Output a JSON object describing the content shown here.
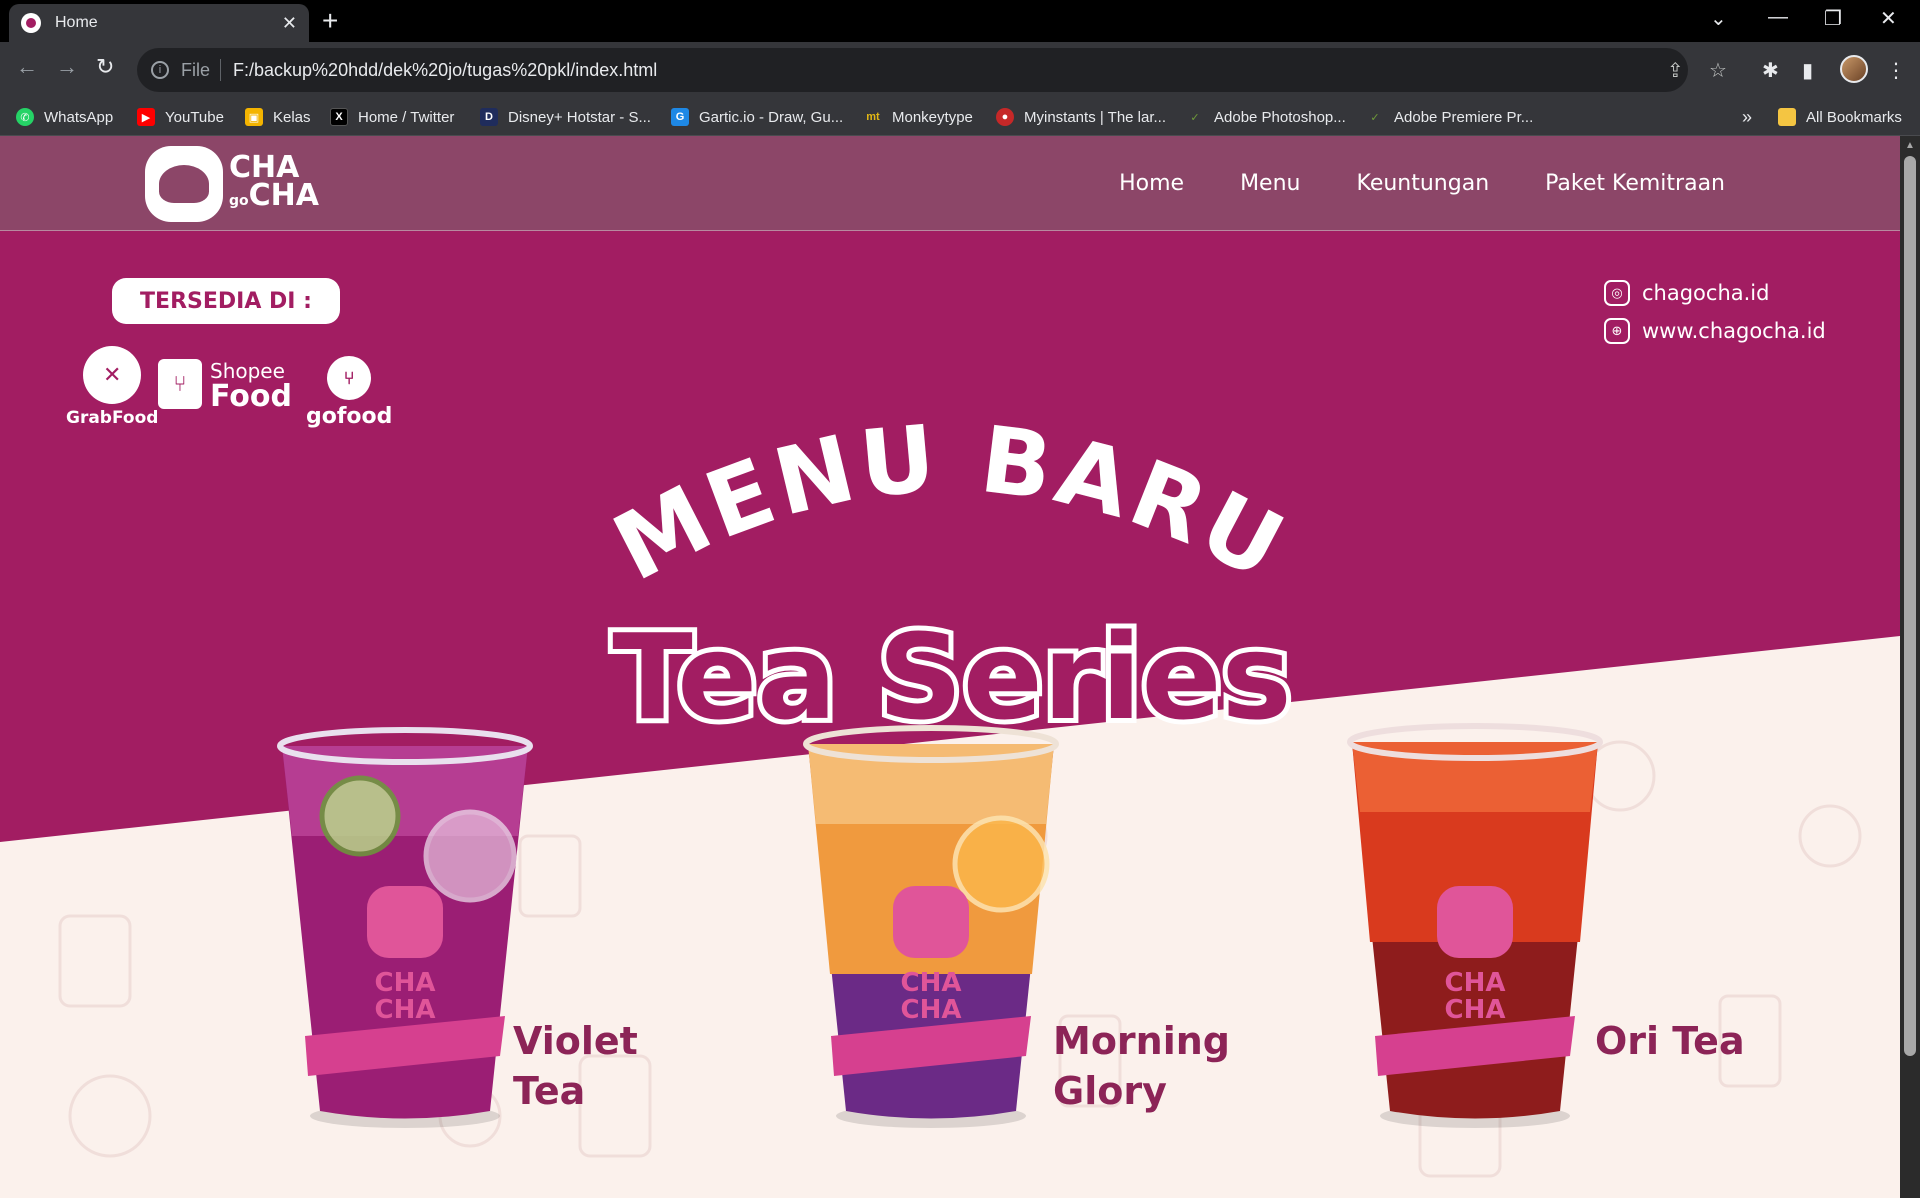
{
  "browser": {
    "tab_title": "Home",
    "url_scheme": "File",
    "url": "F:/backup%20hdd/dek%20jo/tugas%20pkl/index.html",
    "bookmarks": [
      {
        "label": "WhatsApp",
        "icon": "whatsapp-icon",
        "color": "#25d366"
      },
      {
        "label": "YouTube",
        "icon": "youtube-icon",
        "color": "#ff0000"
      },
      {
        "label": "Kelas",
        "icon": "classroom-icon",
        "color": "#f4b400"
      },
      {
        "label": "Home / Twitter",
        "icon": "x-icon",
        "color": "#000000"
      },
      {
        "label": "Disney+ Hotstar - S...",
        "icon": "hotstar-icon",
        "color": "#1f2c5c"
      },
      {
        "label": "Gartic.io - Draw, Gu...",
        "icon": "gartic-icon",
        "color": "#1e88e5"
      },
      {
        "label": "Monkeytype",
        "icon": "monkeytype-icon",
        "color": "#e2b714"
      },
      {
        "label": "Myinstants | The lar...",
        "icon": "myinstants-icon",
        "color": "#c62828"
      },
      {
        "label": "Adobe Photoshop...",
        "icon": "photoshop-icon",
        "color": "#6f9a3a"
      },
      {
        "label": "Adobe Premiere Pr...",
        "icon": "premiere-icon",
        "color": "#6f9a3a"
      }
    ],
    "overflow": "»",
    "all_bookmarks": "All Bookmarks"
  },
  "site": {
    "logo_text_top": "CHA",
    "logo_text_mid": "go",
    "logo_text_bottom": "CHA",
    "nav": [
      "Home",
      "Menu",
      "Keuntungan",
      "Paket Kemitraan"
    ],
    "tersedia": "TERSEDIA DI :",
    "grabfood": "GrabFood",
    "shopee_top": "Shopee",
    "shopee_bottom": "Food",
    "gofood": "gofood",
    "instagram": "chagocha.id",
    "website": "www.chagocha.id",
    "headline": "MENU BARU",
    "subheadline": "Tea Series",
    "cup_brand_top": "CHA",
    "cup_brand_bottom": "CHA",
    "drinks": [
      {
        "line1": "Violet",
        "line2": "Tea"
      },
      {
        "line1": "Morning",
        "line2": "Glory"
      },
      {
        "line1": "Ori Tea",
        "line2": ""
      }
    ],
    "colors": {
      "magenta": "#a21d62",
      "header": "#8c4668",
      "cream": "#fbf1ec",
      "label": "#8c2457"
    }
  }
}
